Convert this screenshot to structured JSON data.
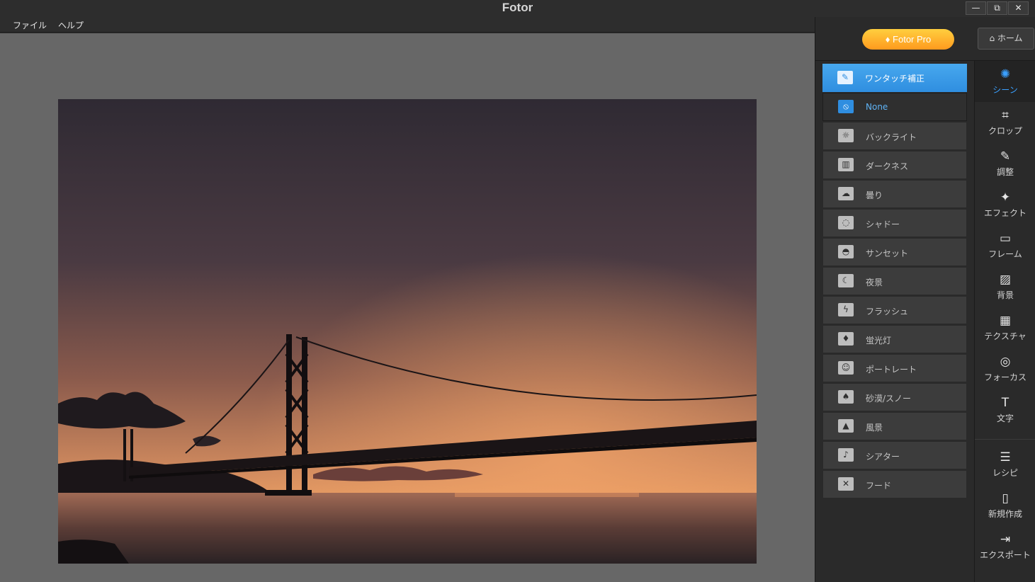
{
  "window": {
    "title": "Fotor",
    "minimize": "—",
    "restore": "⧉",
    "close": "✕"
  },
  "menu": [
    "ファイル",
    "ヘルプ"
  ],
  "header": {
    "pro_label": "Fotor Pro",
    "home_label": "ホーム"
  },
  "scene_panel": {
    "heading": "ワンタッチ補正",
    "items": [
      {
        "label": "None",
        "icon": "none-icon",
        "glyph": "⦸",
        "selected": true
      },
      {
        "label": "バックライト",
        "icon": "backlight-icon",
        "glyph": "☼",
        "selected": false
      },
      {
        "label": "ダークネス",
        "icon": "darkness-icon",
        "glyph": "▥",
        "selected": false
      },
      {
        "label": "曇り",
        "icon": "cloudy-icon",
        "glyph": "☁",
        "selected": false
      },
      {
        "label": "シャドー",
        "icon": "shadow-icon",
        "glyph": "◌",
        "selected": false
      },
      {
        "label": "サンセット",
        "icon": "sunset-icon",
        "glyph": "◓",
        "selected": false
      },
      {
        "label": "夜景",
        "icon": "night-icon",
        "glyph": "☾",
        "selected": false
      },
      {
        "label": "フラッシュ",
        "icon": "flash-icon",
        "glyph": "ϟ",
        "selected": false
      },
      {
        "label": "蛍光灯",
        "icon": "fluorescent-icon",
        "glyph": "♦",
        "selected": false
      },
      {
        "label": "ポートレート",
        "icon": "portrait-icon",
        "glyph": "☺",
        "selected": false
      },
      {
        "label": "砂漠/スノー",
        "icon": "desert-snow-icon",
        "glyph": "♠",
        "selected": false
      },
      {
        "label": "風景",
        "icon": "landscape-icon",
        "glyph": "▲",
        "selected": false
      },
      {
        "label": "シアター",
        "icon": "theater-icon",
        "glyph": "♪",
        "selected": false
      },
      {
        "label": "フード",
        "icon": "food-icon",
        "glyph": "✕",
        "selected": false
      }
    ]
  },
  "tools": [
    {
      "label": "シーン",
      "icon": "scene-icon",
      "glyph": "✺",
      "active": true
    },
    {
      "label": "クロップ",
      "icon": "crop-icon",
      "glyph": "⌗",
      "active": false
    },
    {
      "label": "調整",
      "icon": "adjust-icon",
      "glyph": "✎",
      "active": false
    },
    {
      "label": "エフェクト",
      "icon": "effect-icon",
      "glyph": "✦",
      "active": false
    },
    {
      "label": "フレーム",
      "icon": "frame-icon",
      "glyph": "▭",
      "active": false
    },
    {
      "label": "背景",
      "icon": "background-icon",
      "glyph": "▨",
      "active": false
    },
    {
      "label": "テクスチャ",
      "icon": "texture-icon",
      "glyph": "▦",
      "active": false
    },
    {
      "label": "フォーカス",
      "icon": "focus-icon",
      "glyph": "◎",
      "active": false
    },
    {
      "label": "文字",
      "icon": "text-icon",
      "glyph": "T",
      "active": false
    }
  ],
  "bottom_tools": [
    {
      "label": "レシピ",
      "icon": "recipe-icon",
      "glyph": "☰"
    },
    {
      "label": "新規作成",
      "icon": "new-file-icon",
      "glyph": "▯"
    },
    {
      "label": "エクスポート",
      "icon": "export-icon",
      "glyph": "⇥"
    }
  ],
  "colors": {
    "accent": "#2f8ee0",
    "pro_button": "#ffa726",
    "canvas_bg": "#676767"
  }
}
